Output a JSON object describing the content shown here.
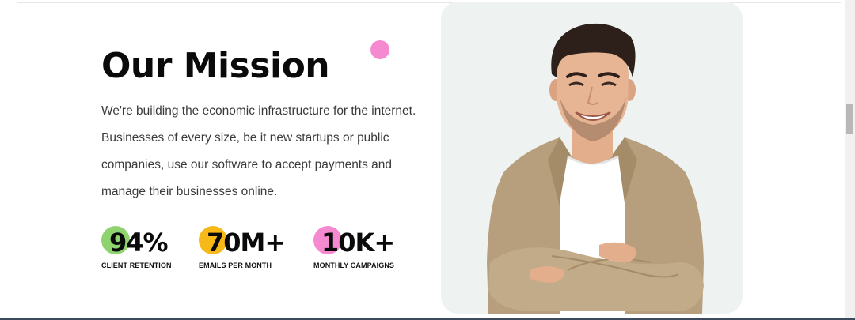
{
  "mission": {
    "title": "Our Mission",
    "description": "We're building the economic infrastructure for the internet. Businesses of every size, be it new startups or public companies, use our software to accept payments and manage their businesses online."
  },
  "stats": [
    {
      "value": "94%",
      "label": "CLIENT RETENTION",
      "color": "#8fd36e"
    },
    {
      "value": "70M+",
      "label": "EMAILS PER MONTH",
      "color": "#f7b918"
    },
    {
      "value": "10K+",
      "label": "MONTHLY CAMPAIGNS",
      "color": "#f58ad1"
    }
  ],
  "colors": {
    "accent_pink": "#f58ad1",
    "card_background": "#eef2f1"
  },
  "image": {
    "subject": "smiling-man-arms-crossed-photo"
  }
}
